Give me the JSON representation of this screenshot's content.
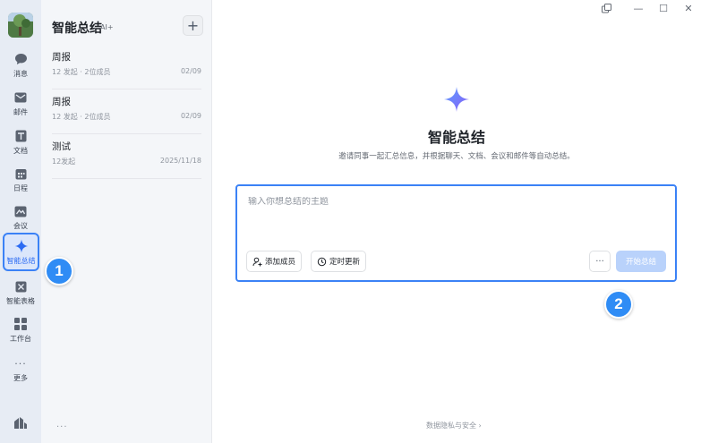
{
  "rail": {
    "items": [
      {
        "label": "消息",
        "icon": "chat-bubble-icon"
      },
      {
        "label": "邮件",
        "icon": "mail-icon"
      },
      {
        "label": "文档",
        "icon": "doc-icon"
      },
      {
        "label": "日程",
        "icon": "calendar-icon"
      },
      {
        "label": "会议",
        "icon": "meeting-icon"
      },
      {
        "label": "智能总结",
        "icon": "sparkle-icon",
        "active": true
      },
      {
        "label": "智能表格",
        "icon": "smart-table-icon"
      },
      {
        "label": "工作台",
        "icon": "grid-icon"
      },
      {
        "label": "更多",
        "icon": "more-dots-icon",
        "glyph": "···"
      }
    ]
  },
  "sidebar": {
    "title": "智能总结",
    "badge": "AI+",
    "add_glyph": "+",
    "items": [
      {
        "title": "周报",
        "sub": "12 发起 · 2位成员",
        "date": "02/09"
      },
      {
        "title": "周报",
        "sub": "12 发起 · 2位成员",
        "date": "02/09"
      },
      {
        "title": "测试",
        "sub": "12发起",
        "date": "2025/11/18"
      }
    ],
    "more": "···"
  },
  "window_controls": {
    "min": "—",
    "max": "☐",
    "close": "✕"
  },
  "main": {
    "title": "智能总结",
    "subtitle": "邀请同事一起汇总信息，并根据聊天、文档、会议和邮件等自动总结。",
    "input_placeholder": "输入你想总结的主题",
    "add_member": "添加成员",
    "scheduled_update": "定时更新",
    "more": "···",
    "start": "开始总结",
    "footer": "数据隐私与安全 ›"
  },
  "callouts": [
    "1",
    "2"
  ],
  "colors": {
    "accent": "#3b82f6",
    "callout": "#2f8cf5",
    "start_disabled": "#b9d2fb"
  }
}
